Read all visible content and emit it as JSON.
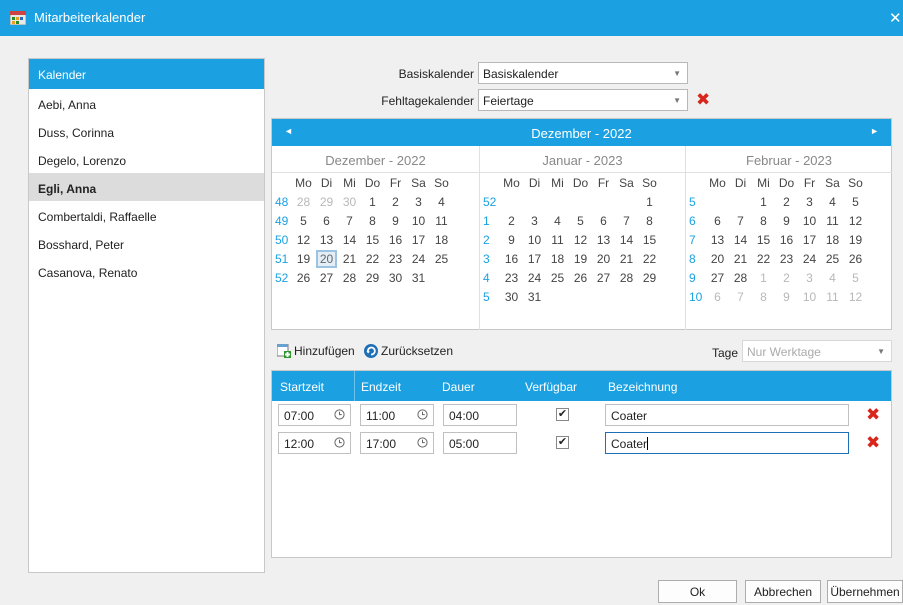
{
  "window": {
    "title": "Mitarbeiterkalender",
    "close_glyph": "✕"
  },
  "employees": {
    "header": "Kalender",
    "items": [
      "Aebi, Anna",
      "Duss, Corinna",
      "Degelo, Lorenzo",
      "Egli, Anna",
      "Combertaldi, Raffaelle",
      "Bosshard, Peter",
      "Casanova, Renato"
    ],
    "selected": "Egli, Anna"
  },
  "form": {
    "basis_label": "Basiskalender",
    "basis_value": "Basiskalender",
    "fehltage_label": "Fehltagekalender",
    "fehltage_value": "Feiertage"
  },
  "calendar": {
    "nav_title": "Dezember - 2022",
    "weekday_headers": [
      "Mo",
      "Di",
      "Mi",
      "Do",
      "Fr",
      "Sa",
      "So"
    ],
    "months": [
      {
        "title": "Dezember - 2022",
        "weeks": [
          {
            "wk": "48",
            "days": [
              "28",
              "29",
              "30",
              "1",
              "2",
              "3",
              "4"
            ],
            "dim": [
              true,
              true,
              true,
              false,
              false,
              false,
              false
            ]
          },
          {
            "wk": "49",
            "days": [
              "5",
              "6",
              "7",
              "8",
              "9",
              "10",
              "11"
            ],
            "dim": [
              false,
              false,
              false,
              false,
              false,
              false,
              false
            ]
          },
          {
            "wk": "50",
            "days": [
              "12",
              "13",
              "14",
              "15",
              "16",
              "17",
              "18"
            ],
            "dim": [
              false,
              false,
              false,
              false,
              false,
              false,
              false
            ]
          },
          {
            "wk": "51",
            "days": [
              "19",
              "20",
              "21",
              "22",
              "23",
              "24",
              "25"
            ],
            "dim": [
              false,
              false,
              false,
              false,
              false,
              false,
              false
            ]
          },
          {
            "wk": "52",
            "days": [
              "26",
              "27",
              "28",
              "29",
              "30",
              "31",
              ""
            ],
            "dim": [
              false,
              false,
              false,
              false,
              false,
              false,
              false
            ]
          },
          {
            "wk": "",
            "days": [
              "",
              "",
              "",
              "",
              "",
              "",
              ""
            ],
            "dim": [
              false,
              false,
              false,
              false,
              false,
              false,
              false
            ]
          }
        ]
      },
      {
        "title": "Januar - 2023",
        "weeks": [
          {
            "wk": "52",
            "days": [
              "",
              "",
              "",
              "",
              "",
              "",
              "1"
            ],
            "dim": [
              false,
              false,
              false,
              false,
              false,
              false,
              false
            ]
          },
          {
            "wk": "1",
            "days": [
              "2",
              "3",
              "4",
              "5",
              "6",
              "7",
              "8"
            ],
            "dim": [
              false,
              false,
              false,
              false,
              false,
              false,
              false
            ]
          },
          {
            "wk": "2",
            "days": [
              "9",
              "10",
              "11",
              "12",
              "13",
              "14",
              "15"
            ],
            "dim": [
              false,
              false,
              false,
              false,
              false,
              false,
              false
            ]
          },
          {
            "wk": "3",
            "days": [
              "16",
              "17",
              "18",
              "19",
              "20",
              "21",
              "22"
            ],
            "dim": [
              false,
              false,
              false,
              false,
              false,
              false,
              false
            ]
          },
          {
            "wk": "4",
            "days": [
              "23",
              "24",
              "25",
              "26",
              "27",
              "28",
              "29"
            ],
            "dim": [
              false,
              false,
              false,
              false,
              false,
              false,
              false
            ]
          },
          {
            "wk": "5",
            "days": [
              "30",
              "31",
              "",
              "",
              "",
              "",
              ""
            ],
            "dim": [
              false,
              false,
              false,
              false,
              false,
              false,
              false
            ]
          }
        ]
      },
      {
        "title": "Februar - 2023",
        "weeks": [
          {
            "wk": "5",
            "days": [
              "",
              "",
              "1",
              "2",
              "3",
              "4",
              "5"
            ],
            "dim": [
              false,
              false,
              false,
              false,
              false,
              false,
              false
            ]
          },
          {
            "wk": "6",
            "days": [
              "6",
              "7",
              "8",
              "9",
              "10",
              "11",
              "12"
            ],
            "dim": [
              false,
              false,
              false,
              false,
              false,
              false,
              false
            ]
          },
          {
            "wk": "7",
            "days": [
              "13",
              "14",
              "15",
              "16",
              "17",
              "18",
              "19"
            ],
            "dim": [
              false,
              false,
              false,
              false,
              false,
              false,
              false
            ]
          },
          {
            "wk": "8",
            "days": [
              "20",
              "21",
              "22",
              "23",
              "24",
              "25",
              "26"
            ],
            "dim": [
              false,
              false,
              false,
              false,
              false,
              false,
              false
            ]
          },
          {
            "wk": "9",
            "days": [
              "27",
              "28",
              "1",
              "2",
              "3",
              "4",
              "5"
            ],
            "dim": [
              false,
              false,
              true,
              true,
              true,
              true,
              true
            ]
          },
          {
            "wk": "10",
            "days": [
              "6",
              "7",
              "8",
              "9",
              "10",
              "11",
              "12"
            ],
            "dim": [
              true,
              true,
              true,
              true,
              true,
              true,
              true
            ]
          }
        ]
      }
    ],
    "highlighted_day": "20"
  },
  "toolbar": {
    "add_label": "Hinzufügen",
    "reset_label": "Zurücksetzen",
    "days_label": "Tage",
    "days_value": "Nur Werktage"
  },
  "grid": {
    "columns": [
      "Startzeit",
      "Endzeit",
      "Dauer",
      "Verfügbar",
      "Bezeichnung"
    ],
    "rows": [
      {
        "start": "07:00",
        "end": "11:00",
        "duration": "04:00",
        "available": true,
        "label": "Coater"
      },
      {
        "start": "12:00",
        "end": "17:00",
        "duration": "05:00",
        "available": true,
        "label": "Coater"
      }
    ]
  },
  "buttons": {
    "ok": "Ok",
    "cancel": "Abbrechen",
    "apply": "Übernehmen"
  },
  "colors": {
    "accent": "#1ba1e2",
    "delete": "#d9261c",
    "selection": "#dcdcdc"
  }
}
